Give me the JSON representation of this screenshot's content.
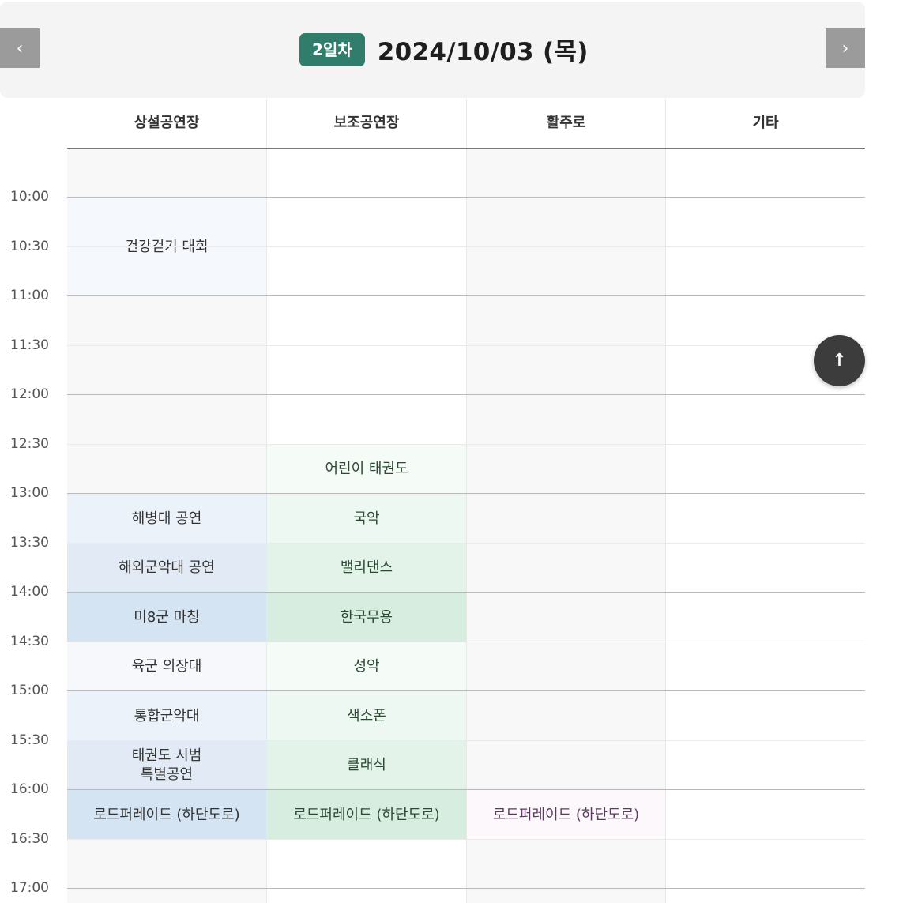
{
  "header": {
    "prev_icon": "‹",
    "next_icon": "›",
    "day_badge": "2일차",
    "date": "2024/10/03 (목)",
    "badge_color": "#2f7d6a"
  },
  "columns": [
    "상설공연장",
    "보조공연장",
    "활주로",
    "기타"
  ],
  "times": [
    "10:00",
    "10:30",
    "11:00",
    "11:30",
    "12:00",
    "12:30",
    "13:00",
    "13:30",
    "14:00",
    "14:30",
    "15:00",
    "15:30",
    "16:00",
    "16:30",
    "17:00"
  ],
  "events": {
    "main": [
      {
        "label": "건강걷기 대회"
      },
      {
        "label": "해병대 공연"
      },
      {
        "label": "해외군악대 공연"
      },
      {
        "label": "미8군 마칭"
      },
      {
        "label": "육군 의장대"
      },
      {
        "label": "통합군악대"
      },
      {
        "label": "태권도 시범 특별공연"
      },
      {
        "label": "로드퍼레이드 (하단도로)"
      }
    ],
    "sub": [
      {
        "label": "어린이 태권도"
      },
      {
        "label": "국악"
      },
      {
        "label": "밸리댄스"
      },
      {
        "label": "한국무용"
      },
      {
        "label": "성악"
      },
      {
        "label": "색소폰"
      },
      {
        "label": "클래식"
      },
      {
        "label": "로드퍼레이드 (하단도로)"
      }
    ],
    "runway": [
      {
        "label": "로드퍼레이드 (하단도로)"
      }
    ]
  },
  "scroll_top_icon": "↑"
}
